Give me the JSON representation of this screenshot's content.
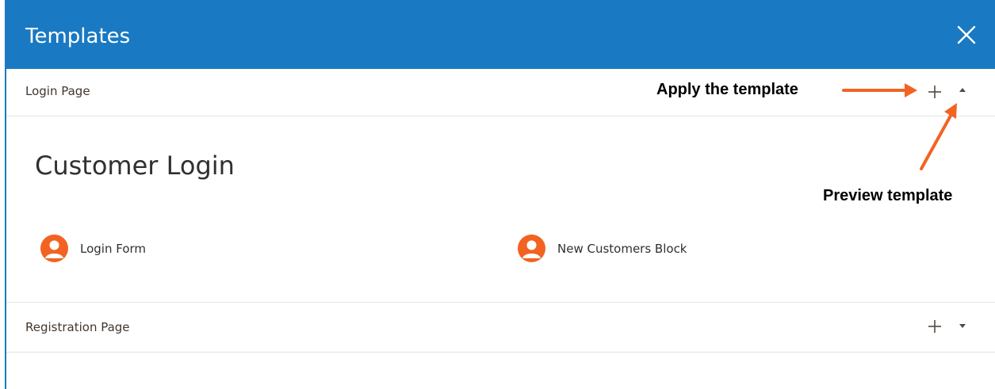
{
  "modal": {
    "title": "Templates",
    "close_icon": "close-icon"
  },
  "templates": [
    {
      "name": "Login Page",
      "expanded": true,
      "preview": {
        "title": "Customer Login",
        "blocks": [
          {
            "label": "Login Form",
            "icon": "user-icon"
          },
          {
            "label": "New Customers Block",
            "icon": "user-icon"
          }
        ]
      }
    },
    {
      "name": "Registration Page",
      "expanded": false
    }
  ],
  "annotations": {
    "apply": "Apply the template",
    "preview": "Preview template"
  },
  "colors": {
    "header": "#1979c3",
    "accent_orange": "#eb5202",
    "annotation_arrow": "#f26322"
  }
}
